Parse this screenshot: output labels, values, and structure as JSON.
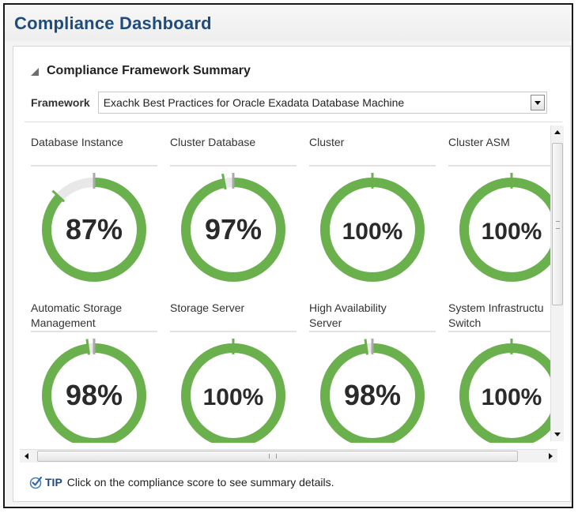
{
  "page": {
    "title": "Compliance Dashboard"
  },
  "section": {
    "title": "Compliance Framework Summary",
    "collapse_icon": "collapse-triangle-icon"
  },
  "framework": {
    "label": "Framework",
    "selected": "Exachk Best Practices for Oracle Exadata Database Machine"
  },
  "gauges": [
    {
      "label_lines": [
        "Database Instance"
      ],
      "score": 87,
      "score_text": "87%"
    },
    {
      "label_lines": [
        "Cluster Database"
      ],
      "score": 97,
      "score_text": "97%"
    },
    {
      "label_lines": [
        "Cluster"
      ],
      "score": 100,
      "score_text": "100%"
    },
    {
      "label_lines": [
        "Cluster ASM"
      ],
      "score": 100,
      "score_text": "100%"
    },
    {
      "label_lines": [
        "Automatic Storage",
        "Management"
      ],
      "score": 98,
      "score_text": "98%"
    },
    {
      "label_lines": [
        "Storage Server"
      ],
      "score": 100,
      "score_text": "100%"
    },
    {
      "label_lines": [
        "High Availability",
        "Server"
      ],
      "score": 98,
      "score_text": "98%"
    },
    {
      "label_lines": [
        "System Infrastructu",
        "Switch"
      ],
      "score": 100,
      "score_text": "100%"
    }
  ],
  "scrollbar_grip_text": "III",
  "tip": {
    "icon": "checkmark-icon",
    "label": "TIP",
    "text": "Click on the compliance score to see summary details."
  },
  "colors": {
    "title": "#1e4c7c",
    "gauge_fill": "#6ab04c",
    "gauge_track": "#e8e8e8",
    "gauge_tick": "#aaaaaa"
  }
}
